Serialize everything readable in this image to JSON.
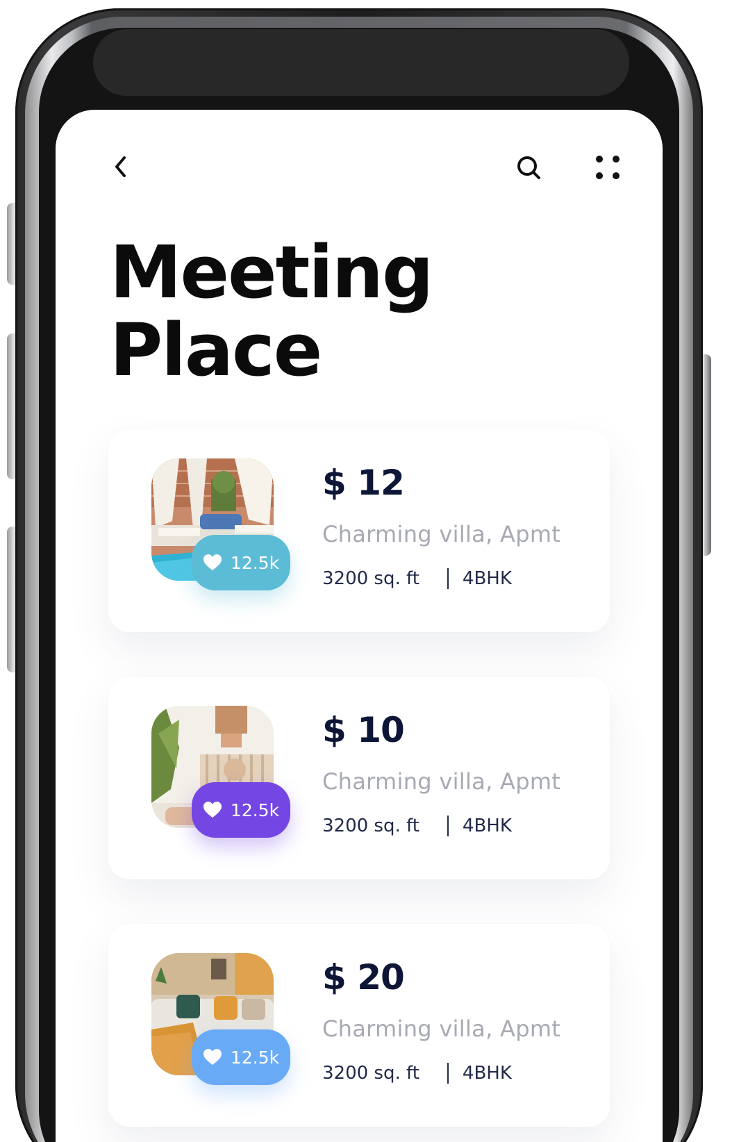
{
  "header": {
    "back_icon": "chevron-left-icon",
    "search_icon": "search-icon",
    "menu_icon": "dots-grid-icon"
  },
  "page": {
    "title_line1": "Meeting",
    "title_line2": "Place"
  },
  "listings": [
    {
      "price": "$ 12",
      "name": "Charming villa, Apmt",
      "area": "3200 sq. ft",
      "rooms": "4BHK",
      "likes": "12.5k",
      "badge_color": "#5cbcd6",
      "heart_icon": "heart-icon"
    },
    {
      "price": "$ 10",
      "name": "Charming villa, Apmt",
      "area": "3200 sq. ft",
      "rooms": "4BHK",
      "likes": "12.5k",
      "badge_color": "#7447e4",
      "heart_icon": "heart-icon"
    },
    {
      "price": "$ 20",
      "name": "Charming villa, Apmt",
      "area": "3200 sq. ft",
      "rooms": "4BHK",
      "likes": "12.5k",
      "badge_color": "#69aaf7",
      "heart_icon": "heart-icon"
    }
  ],
  "colors": {
    "title": "#0b0b0c",
    "price": "#0d1636",
    "subtitle": "#a7a9b3",
    "detail": "#222a4a"
  }
}
